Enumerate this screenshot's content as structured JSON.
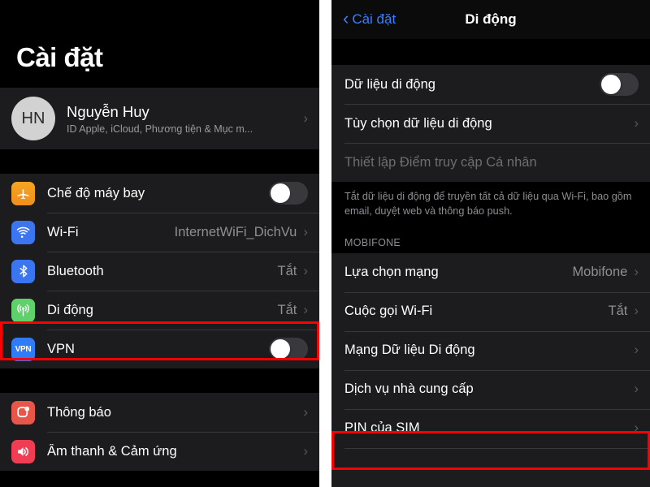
{
  "left_panel": {
    "title": "Cài đặt",
    "account": {
      "initials": "HN",
      "name": "Nguyễn Huy",
      "subtitle": "ID Apple, iCloud, Phương tiện & Mục m..."
    },
    "group1": [
      {
        "icon": "airplane-icon",
        "label": "Chế độ máy bay",
        "control": "toggle",
        "toggle_on": false
      },
      {
        "icon": "wifi-icon",
        "label": "Wi-Fi",
        "value": "InternetWiFi_DichVu",
        "control": "chevron"
      },
      {
        "icon": "bluetooth-icon",
        "label": "Bluetooth",
        "value": "Tắt",
        "control": "chevron"
      },
      {
        "icon": "cellular-icon",
        "label": "Di động",
        "value": "Tắt",
        "control": "chevron",
        "highlighted": true
      },
      {
        "icon": "vpn-icon",
        "label": "VPN",
        "control": "toggle",
        "toggle_on": false
      }
    ],
    "group2": [
      {
        "icon": "notifications-icon",
        "label": "Thông báo",
        "control": "chevron"
      },
      {
        "icon": "sounds-icon",
        "label": "Âm thanh & Cảm ứng",
        "control": "chevron"
      }
    ]
  },
  "right_panel": {
    "back_label": "Cài đặt",
    "title": "Di động",
    "group1": [
      {
        "label": "Dữ liệu di động",
        "control": "toggle",
        "toggle_on": false
      },
      {
        "label": "Tùy chọn dữ liệu di động",
        "control": "chevron"
      },
      {
        "label": "Thiết lập Điểm truy cập Cá nhân",
        "control": "none",
        "disabled": true
      }
    ],
    "footer_note": "Tắt dữ liệu di động để truyền tất cả dữ liệu qua Wi-Fi, bao gồm email, duyệt web và thông báo push.",
    "section_header": "MOBIFONE",
    "group2": [
      {
        "label": "Lựa chọn mạng",
        "value": "Mobifone",
        "control": "chevron"
      },
      {
        "label": "Cuộc gọi Wi-Fi",
        "value": "Tắt",
        "control": "chevron"
      },
      {
        "label": "Mạng Dữ liệu Di động",
        "control": "chevron"
      },
      {
        "label": "Dịch vụ nhà cung cấp",
        "control": "chevron"
      },
      {
        "label": "PIN của SIM",
        "control": "chevron",
        "highlighted": true
      }
    ]
  },
  "colors": {
    "highlight": "#ff0000",
    "accent_blue": "#3d7eff",
    "row_bg": "#1c1c1e",
    "page_bg": "#000000"
  },
  "icons": {
    "chevron": "›",
    "back_chevron": "‹",
    "vpn_text": "VPN"
  }
}
